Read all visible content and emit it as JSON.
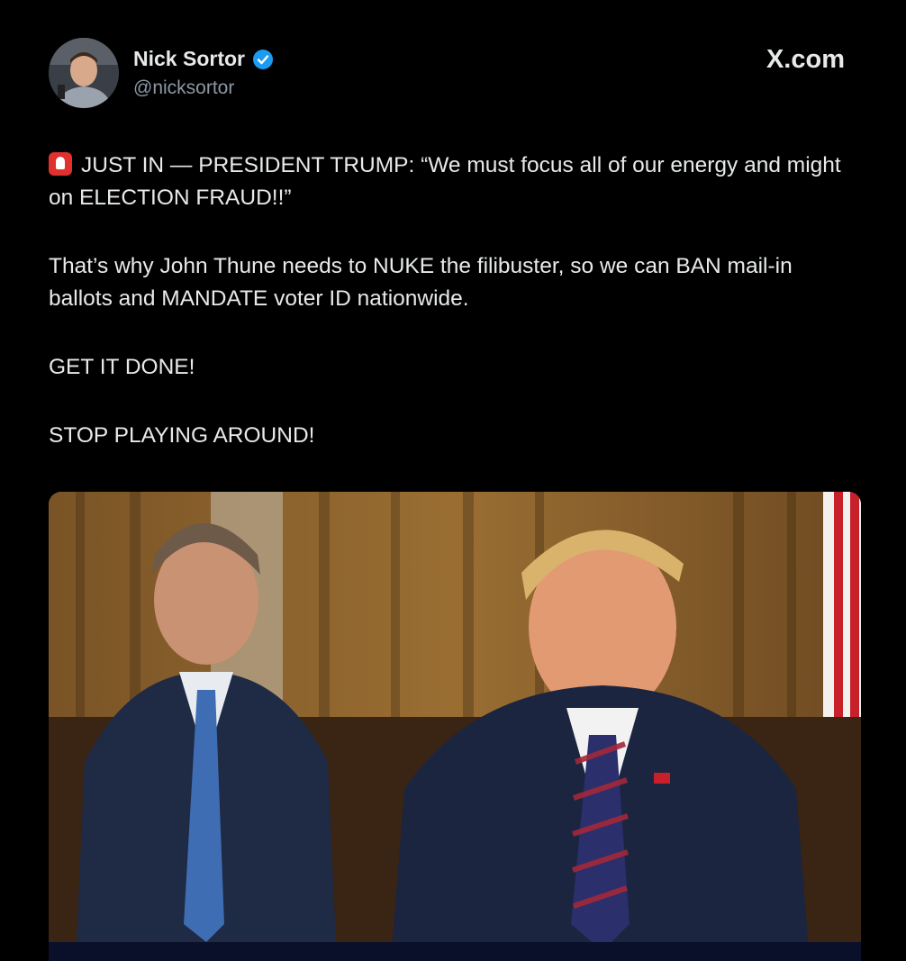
{
  "author": {
    "name": "Nick Sortor",
    "handle": "@nicksortor",
    "verified": true,
    "avatar_icon": "profile-photo"
  },
  "site_label": "X.com",
  "post": {
    "line1": "JUST IN — PRESIDENT TRUMP: “We must focus all of our energy and might on ELECTION FRAUD!!”",
    "line2": "That’s why John Thune needs to NUKE the filibuster, so we can BAN mail-in ballots and MANDATE voter ID nationwide.",
    "line3": "GET IT DONE!",
    "line4": "STOP PLAYING AROUND!",
    "emoji_icon": "police-siren-icon"
  },
  "colors": {
    "background": "#000000",
    "text": "#e7e9ea",
    "secondary_text": "#8b98a5",
    "verified_blue": "#1d9bf0"
  }
}
